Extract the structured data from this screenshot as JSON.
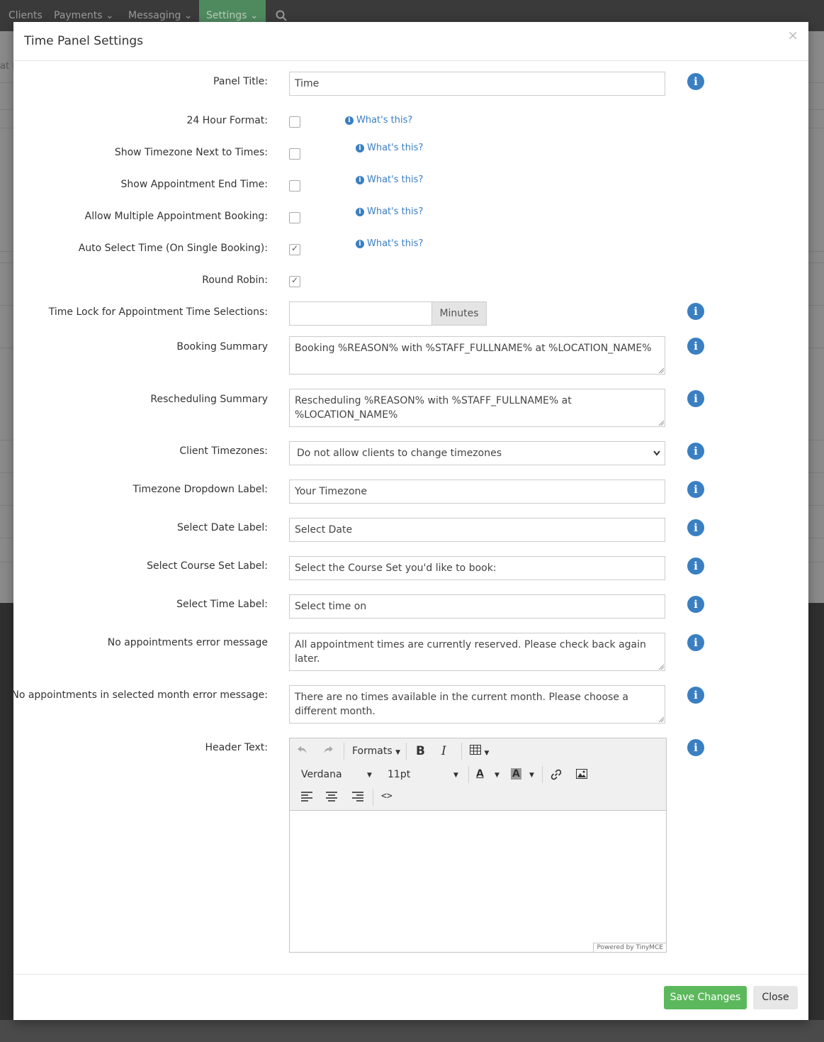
{
  "nav": {
    "items": [
      "Clients",
      "Payments",
      "Messaging",
      "Settings"
    ],
    "partial_text": "at I"
  },
  "modal": {
    "title": "Time Panel Settings",
    "close_glyph": "×"
  },
  "whats_this": "What's this?",
  "fields": {
    "panel_title": {
      "label": "Panel Title:",
      "value": "Time"
    },
    "hour24": {
      "label": "24 Hour Format:",
      "checked": false
    },
    "show_timezone": {
      "label": "Show Timezone Next to Times:",
      "checked": false
    },
    "show_end_time": {
      "label": "Show Appointment End Time:",
      "checked": false
    },
    "multi_booking": {
      "label": "Allow Multiple Appointment Booking:",
      "checked": false
    },
    "auto_select": {
      "label": "Auto Select Time (On Single Booking):",
      "checked": true
    },
    "round_robin": {
      "label": "Round Robin:",
      "checked": true
    },
    "time_lock": {
      "label": "Time Lock for Appointment Time Selections:",
      "value": "",
      "addon": "Minutes"
    },
    "booking_summary": {
      "label": "Booking Summary",
      "value": "Booking %REASON% with %STAFF_FULLNAME% at %LOCATION_NAME%"
    },
    "rescheduling_summary": {
      "label": "Rescheduling Summary",
      "value": "Rescheduling %REASON% with %STAFF_FULLNAME% at %LOCATION_NAME%"
    },
    "client_timezones": {
      "label": "Client Timezones:",
      "value": "Do not allow clients to change timezones"
    },
    "timezone_label": {
      "label": "Timezone Dropdown Label:",
      "value": "Your Timezone"
    },
    "select_date_label": {
      "label": "Select Date Label:",
      "value": "Select Date"
    },
    "select_course_label": {
      "label": "Select Course Set Label:",
      "value": "Select the Course Set you'd like to book:"
    },
    "select_time_label": {
      "label": "Select Time Label:",
      "value": "Select time on"
    },
    "no_appts_error": {
      "label": "No appointments error message",
      "value": "All appointment times are currently reserved. Please check back again later."
    },
    "no_appts_month_error": {
      "label": "No appointments in selected month error message:",
      "value": "There are no times available in the current month. Please choose a different month."
    },
    "header_text": {
      "label": "Header Text:"
    }
  },
  "editor": {
    "formats": "Formats",
    "font": "Verdana",
    "size": "11pt",
    "powered_by": "Powered by TinyMCE",
    "content": ""
  },
  "footer": {
    "save_label": "Save Changes",
    "close_label": "Close"
  },
  "colors": {
    "accent": "#3a7fc1",
    "save": "#5cb85c",
    "active_nav": "#4f8a5f"
  }
}
